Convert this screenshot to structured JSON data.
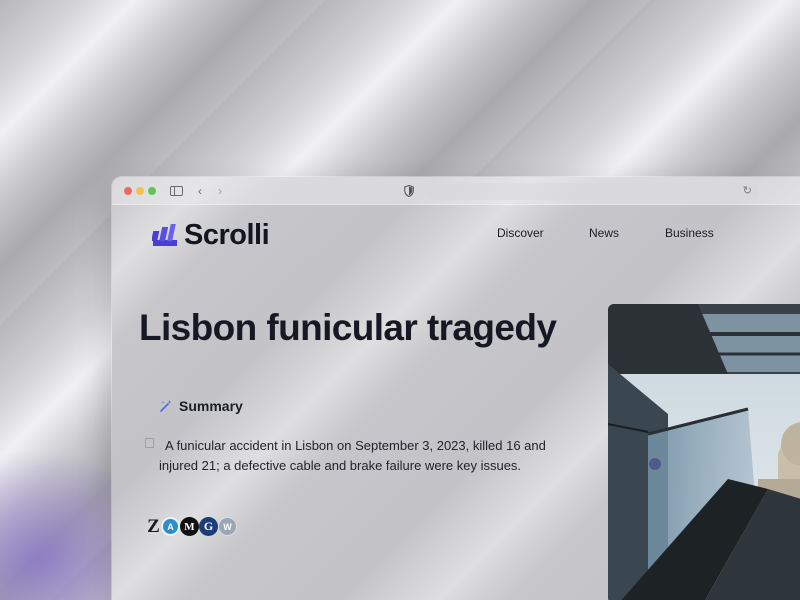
{
  "browser": {
    "traffic_lights": [
      "close",
      "minimize",
      "zoom"
    ],
    "icons": [
      "sidebar-icon",
      "back-icon",
      "forward-icon",
      "shield-icon",
      "reload-icon"
    ],
    "back_glyph": "‹",
    "forward_glyph": "›",
    "reload_glyph": "↻"
  },
  "site": {
    "brand": "Scrolli",
    "brand_color": "#4a3fd1",
    "nav": [
      "Discover",
      "News",
      "Business"
    ]
  },
  "article": {
    "headline": "Lisbon funicular tragedy",
    "summary_label": "Summary",
    "summary_text": "A funicular accident in Lisbon on September 3, 2023, killed 16 and injured 21; a defective cable and brake failure were key issues.",
    "sources": [
      "Z",
      "A",
      "M",
      "G",
      "W"
    ],
    "image_subject": "escalator and glass skylight with cathedral dome"
  }
}
